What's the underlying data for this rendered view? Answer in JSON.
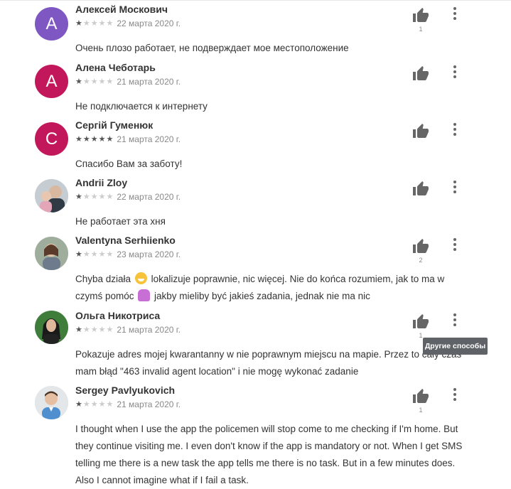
{
  "tooltip": {
    "text": "Другие способы"
  },
  "reviews": [
    {
      "name": "Алексей Москович",
      "initial": "А",
      "avatar_color": "#7e57c2",
      "rating": 1,
      "date": "22 марта 2020 г.",
      "likes": "1",
      "text_parts": [
        "Очень плозо работает, не подверждает мое местоположение"
      ]
    },
    {
      "name": "Алена Чеботарь",
      "initial": "А",
      "avatar_color": "#c2185b",
      "rating": 1,
      "date": "21 марта 2020 г.",
      "likes": "",
      "text_parts": [
        "Не подключается к интернету"
      ]
    },
    {
      "name": "Сергій Гуменюк",
      "initial": "С",
      "avatar_color": "#c2185b",
      "rating": 5,
      "date": "21 марта 2020 г.",
      "likes": "",
      "text_parts": [
        "Спасибо Вам за заботу!"
      ]
    },
    {
      "name": "Andrii Zloy",
      "initial": "",
      "avatar_color": "#90a4ae",
      "rating": 1,
      "date": "22 марта 2020 г.",
      "likes": "",
      "text_parts": [
        "Не работает эта хня"
      ]
    },
    {
      "name": "Valentyna Serhiienko",
      "initial": "",
      "avatar_color": "#8d9e9a",
      "rating": 1,
      "date": "23 марта 2020 г.",
      "likes": "2",
      "text_parts": [
        "Chyba działa ",
        " lokalizuje poprawnie, nic więcej. Nie do końca rozumiem, jak to ma w czymś pomóc ",
        " jakby mieliby być jakieś zadania, jednak nie ma nic"
      ],
      "emoji_icons": [
        "grinning-face-icon",
        "person-shrugging-icon"
      ]
    },
    {
      "name": "Ольга Никотриса",
      "initial": "",
      "avatar_color": "#2e7d32",
      "rating": 1,
      "date": "21 марта 2020 г.",
      "likes": "1",
      "text_parts": [
        "Pokazuje adres mojej kwarantanny w nie poprawnym miejscu na mapie. Przez to cały czas mam błąd \"463 invalid agent location\" i nie mogę wykonać zadanie"
      ]
    },
    {
      "name": "Sergey Pavlyukovich",
      "initial": "",
      "avatar_color": "#b0bec5",
      "rating": 1,
      "date": "21 марта 2020 г.",
      "likes": "1",
      "text_parts": [
        "I thought when I use the app the policemen will stop come to me checking if I'm home. But they continue visiting me. I even don't know if the app is mandatory or not. When I get SMS telling me there is a new task the app tells me there is no task. But in a few minutes does. Also I cannot imagine what if I fail a task."
      ]
    }
  ]
}
